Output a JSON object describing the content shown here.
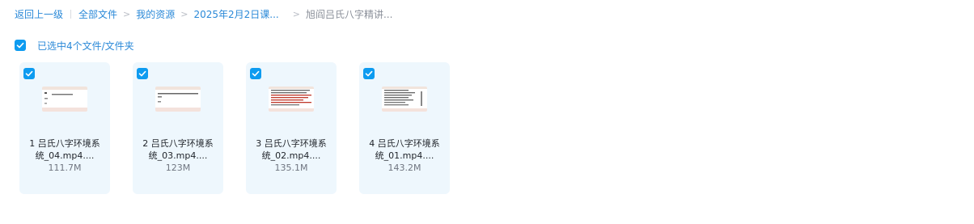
{
  "breadcrumb": {
    "back": "返回上一级",
    "all_files": "全部文件",
    "sep1": ">",
    "my_resources": "我的资源",
    "sep2": ">",
    "course": "2025年2月2日课...",
    "sep3": ">",
    "current": "旭阎吕氏八字精讲..."
  },
  "selection": {
    "text": "已选中4个文件/文件夹",
    "checked": true
  },
  "files": [
    {
      "name_line1": "1 吕氏八字环境系",
      "name_line2": "统_04.mp4....",
      "size": "111.7M",
      "checked": true
    },
    {
      "name_line1": "2 吕氏八字环境系",
      "name_line2": "统_03.mp4....",
      "size": "123M",
      "checked": true
    },
    {
      "name_line1": "3 吕氏八字环境系",
      "name_line2": "统_02.mp4....",
      "size": "135.1M",
      "checked": true
    },
    {
      "name_line1": "4 吕氏八字环境系",
      "name_line2": "统_01.mp4....",
      "size": "143.2M",
      "checked": true
    }
  ],
  "colors": {
    "accent": "#0d9bf0",
    "link": "#2a89d8",
    "card_bg": "#eef7fd"
  },
  "icons": {
    "checkbox": "check-icon",
    "file_thumbnail": "video-thumbnail-icon"
  }
}
